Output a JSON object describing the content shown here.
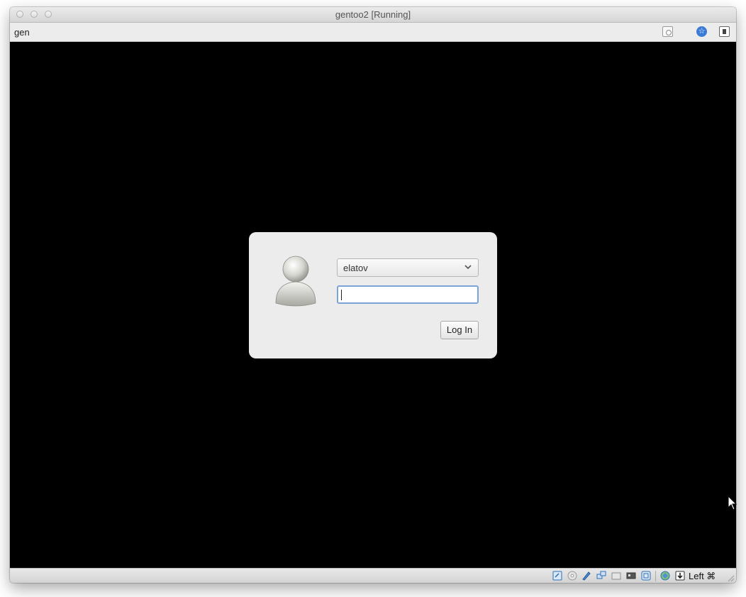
{
  "window": {
    "title": "gentoo2 [Running]",
    "menu_text": "gen"
  },
  "menubar_icons": [
    "document-search-icon",
    "accessibility-icon",
    "panel-toggle-icon"
  ],
  "login": {
    "username": "elatov",
    "password_value": "",
    "login_button_label": "Log In"
  },
  "statusbar": {
    "icons": [
      "hard-disk-icon",
      "optical-drive-icon",
      "usb-pen-icon",
      "network-icon",
      "shared-folder-icon",
      "display-icon",
      "video-capture-icon",
      "virtualization-icon",
      "mouse-integration-icon"
    ],
    "host_key": "Left ⌘"
  },
  "colors": {
    "screen_bg": "#000000",
    "dialog_bg": "#ececec",
    "focus_ring": "#7aa3d8",
    "accessibility_blue": "#3a7bd5"
  }
}
